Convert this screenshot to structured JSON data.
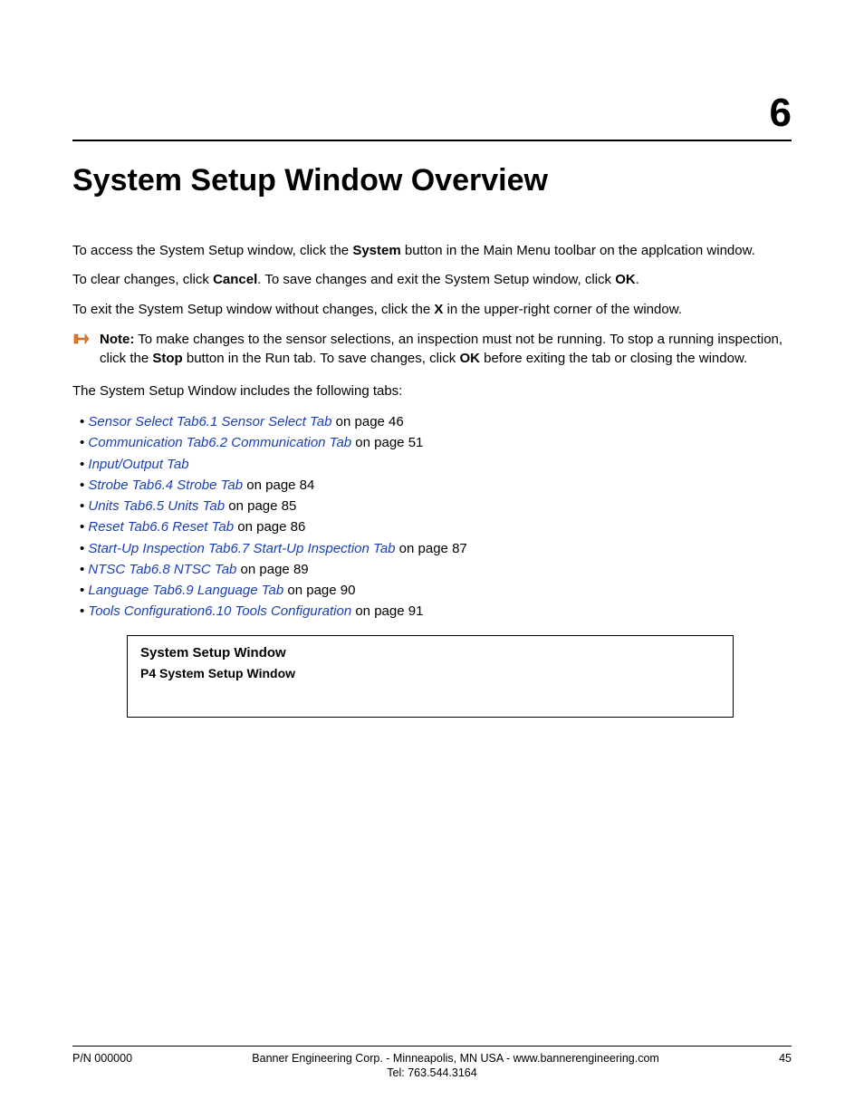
{
  "chapter_number": "6",
  "title": "System Setup Window Overview",
  "para1": {
    "pre": "To access the System Setup window, click the ",
    "b1": "System",
    "post": " button in the Main Menu toolbar on the applcation window."
  },
  "para2": {
    "pre": "To clear changes, click ",
    "b1": "Cancel",
    "mid": ". To save changes and exit the System Setup window, click ",
    "b2": "OK",
    "post": "."
  },
  "para3": {
    "pre": "To exit the System Setup window without changes, click the ",
    "b1": "X",
    "post": " in the upper-right corner of the window."
  },
  "note": {
    "label": "Note:",
    "t1": "  To make changes to the sensor selections, an inspection must not be running. To stop a running inspection, click the ",
    "b1": "Stop",
    "t2": " button in the Run tab. To save changes, click ",
    "b2": "OK",
    "t3": " before exiting the tab or closing the window."
  },
  "para4": "The System Setup Window includes the following tabs:",
  "tabs": [
    {
      "link": "Sensor Select Tab6.1 Sensor Select Tab",
      "suffix": " on page 46"
    },
    {
      "link": "Communication Tab6.2 Communication Tab",
      "suffix": " on page 51"
    },
    {
      "link": "Input/Output Tab",
      "suffix": ""
    },
    {
      "link": "Strobe Tab6.4 Strobe Tab",
      "suffix": " on page 84"
    },
    {
      "link": "Units Tab6.5 Units Tab",
      "suffix": " on page 85"
    },
    {
      "link": "Reset Tab6.6 Reset Tab",
      "suffix": " on page 86"
    },
    {
      "link": "Start-Up Inspection Tab6.7 Start-Up Inspection Tab",
      "suffix": " on page 87"
    },
    {
      "link": "NTSC Tab6.8 NTSC Tab",
      "suffix": " on page 89"
    },
    {
      "link": "Language Tab6.9 Language Tab",
      "suffix": " on page 90"
    },
    {
      "link": "Tools Configuration6.10 Tools Configuration",
      "suffix": " on page 91"
    }
  ],
  "figure": {
    "title": "System Setup Window",
    "subtitle": "P4 System Setup Window"
  },
  "footer": {
    "left": "P/N 000000",
    "center": "Banner Engineering Corp. - Minneapolis, MN USA - www.bannerengineering.com",
    "tel": "Tel: 763.544.3164",
    "right": "45"
  }
}
